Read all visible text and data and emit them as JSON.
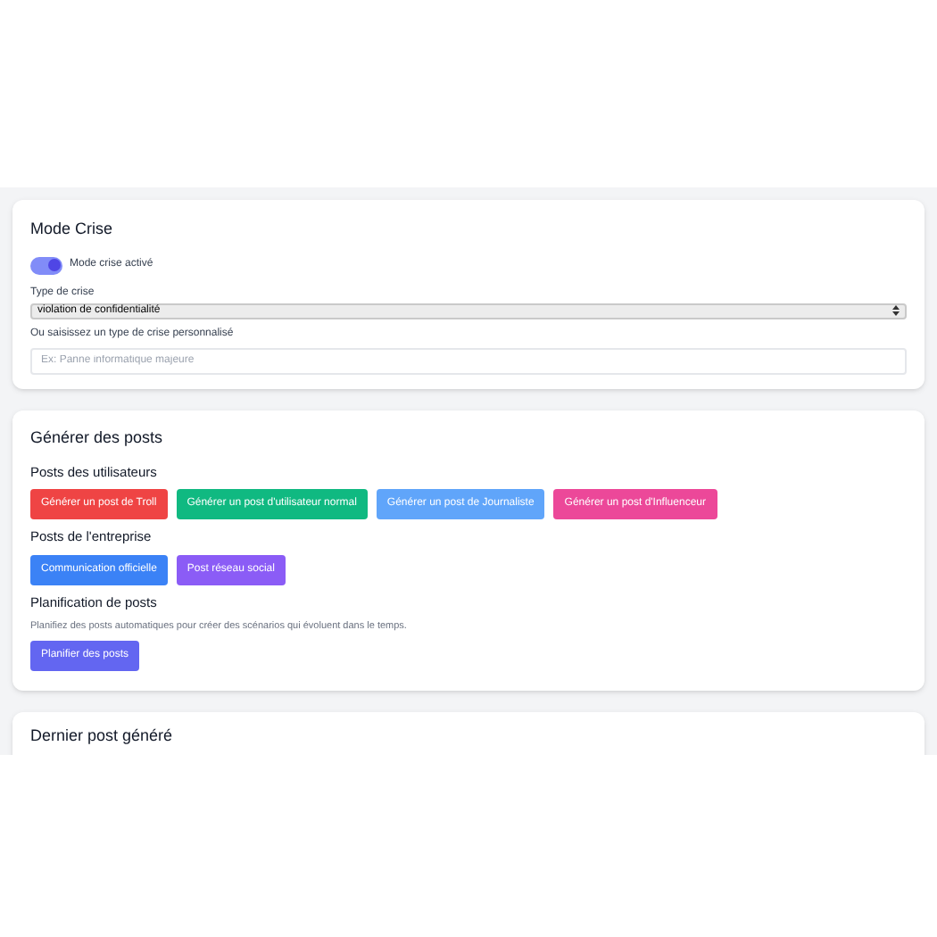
{
  "crisis_mode": {
    "title": "Mode Crise",
    "toggle": {
      "label": "Mode crise activé",
      "on": true
    },
    "type_label": "Type de crise",
    "type_value": "violation de confidentialité",
    "custom_label": "Ou saisissez un type de crise personnalisé",
    "custom_placeholder": "Ex: Panne informatique majeure"
  },
  "generate": {
    "title": "Générer des posts",
    "sections": [
      {
        "title": "Posts des utilisateurs",
        "buttons": [
          {
            "label": "Générer un post de Troll",
            "color": "#ef4444"
          },
          {
            "label": "Générer un post d'utilisateur normal",
            "color": "#10b981"
          },
          {
            "label": "Générer un post de Journaliste",
            "color": "#60a5fa"
          },
          {
            "label": "Générer un post d'Influenceur",
            "color": "#ec4899"
          }
        ]
      },
      {
        "title": "Posts de l'entreprise",
        "buttons": [
          {
            "label": "Communication officielle",
            "color": "#3b82f6"
          },
          {
            "label": "Post réseau social",
            "color": "#8b5cf6"
          }
        ]
      },
      {
        "title": "Planification de posts",
        "description": "Planifiez des posts automatiques pour créer des scénarios qui évoluent dans le temps.",
        "buttons": [
          {
            "label": "Planifier des posts",
            "color": "#6366f1"
          }
        ]
      }
    ]
  },
  "last_post": {
    "title": "Dernier post généré"
  }
}
